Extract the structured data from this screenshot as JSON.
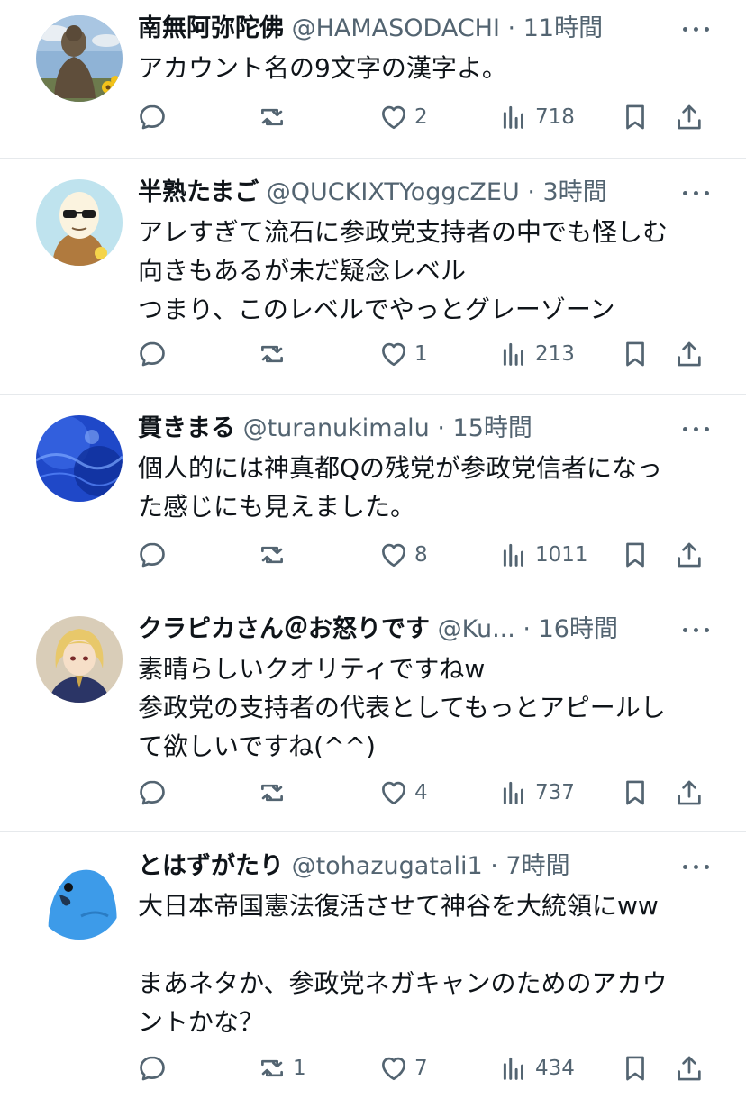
{
  "tweets": [
    {
      "name": "南無阿弥陀佛",
      "handle": "@HAMASODACHI",
      "time": "11時間",
      "lines": [
        "アカウント名の9文字の漢字よ。"
      ],
      "replies": "",
      "retweets": "",
      "likes": "2",
      "views": "718",
      "avatar": "buddha-statue-avatar"
    },
    {
      "name": "半熟たまご",
      "handle": "@QUCKIXTYoggcZEU",
      "time": "3時間",
      "lines": [
        "アレすぎて流石に参政党支持者の中でも怪しむ",
        "向きもあるが未だ疑念レベル",
        "つまり、このレベルでやっとグレーゾーン"
      ],
      "replies": "",
      "retweets": "",
      "likes": "1",
      "views": "213",
      "avatar": "egg-character-avatar"
    },
    {
      "name": "貫きまる",
      "handle": "@turanukimalu",
      "time": "15時間",
      "lines": [
        "個人的には神真都Qの残党が参政党信者になっ",
        "た感じにも見えました。"
      ],
      "replies": "",
      "retweets": "",
      "likes": "8",
      "views": "1011",
      "avatar": "blue-texture-avatar"
    },
    {
      "name": "クラピカさん＠お怒りです",
      "handle": "@Ku...",
      "time": "16時間",
      "lines": [
        "素晴らしいクオリティですねw",
        "参政党の支持者の代表としてもっとアピールし",
        "て欲しいですね(^^)"
      ],
      "replies": "",
      "retweets": "",
      "likes": "4",
      "views": "737",
      "avatar": "anime-character-avatar"
    },
    {
      "name": "とはずがたり",
      "handle": "@tohazugatali1",
      "time": "7時間",
      "lines": [
        "大日本帝国憲法復活させて神谷を大統領にww",
        "",
        "まあネタか、参政党ネガキャンのためのアカウ",
        "ントかな？"
      ],
      "replies": "",
      "retweets": "1",
      "likes": "7",
      "views": "434",
      "avatar": "blue-parakeet-avatar"
    }
  ],
  "separator": "·",
  "colors": {
    "text": "#0f1419",
    "secondary": "#536471",
    "divider": "#e6e9ec"
  },
  "icons": [
    "reply-icon",
    "retweet-icon",
    "like-icon",
    "views-icon",
    "bookmark-icon",
    "share-icon",
    "more-icon"
  ]
}
